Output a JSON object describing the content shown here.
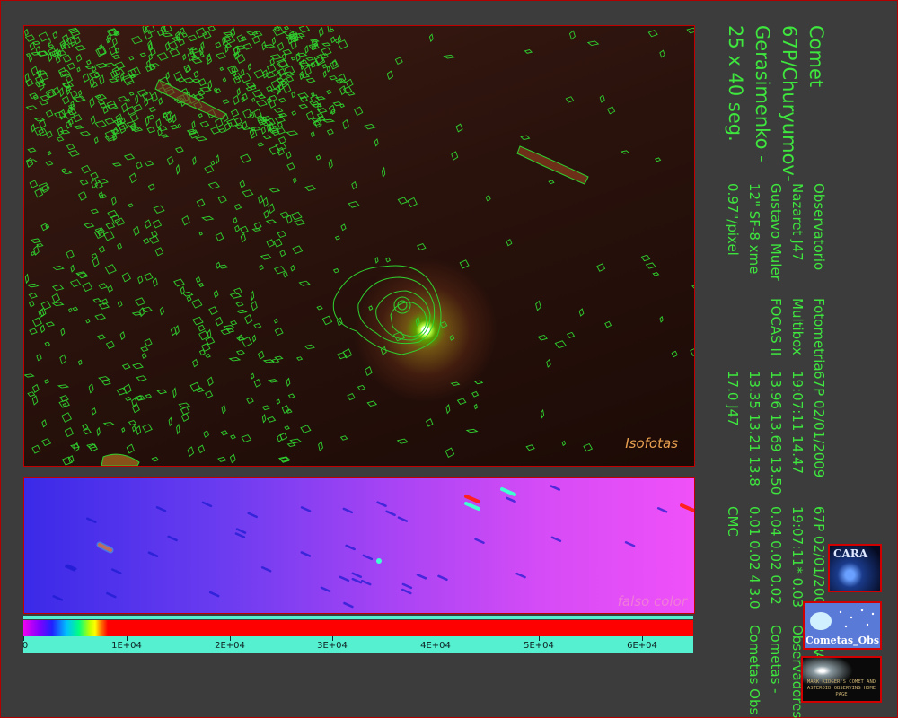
{
  "panels": {
    "isophotes_label": "Isofotas",
    "false_color_label": "falso color"
  },
  "scale": {
    "tick_labels": [
      "0",
      "1E+04",
      "2E+04",
      "3E+04",
      "4E+04",
      "5E+04",
      "6E+04"
    ],
    "max_value": 65000
  },
  "caption": {
    "title": "Comet 67P/Churyumov-Gerasimenko - 25 x 40 seg.",
    "lines": [
      "Observatorio Nazaret J47 Gustavo Muler 12\" SF-8 xme 0.97\"/pixel",
      "Fotometria Multibox FOCAS II",
      "67P 02/01/2009 19:07:11 14.47 13.96 13.69 13.50 13.35 13.21 13.8 17.0 J47",
      "67P 02/01/2009 19:07:11* 0.03 0.04 0.02 0.02 0.01 0.02 4 3.0 CMC",
      "CARA- Observadores Cometas - Cometas Obs"
    ]
  },
  "logos": {
    "cara": "CARA",
    "cometas_obs": "Cometas_Obs",
    "kidger": "MARK KIDGER'S COMET AND ASTEROID OBSERVING HOME PAGE"
  },
  "colors": {
    "caption_text": "#3ee63e",
    "frame_border": "#c00000",
    "background": "#3c3c3c"
  }
}
